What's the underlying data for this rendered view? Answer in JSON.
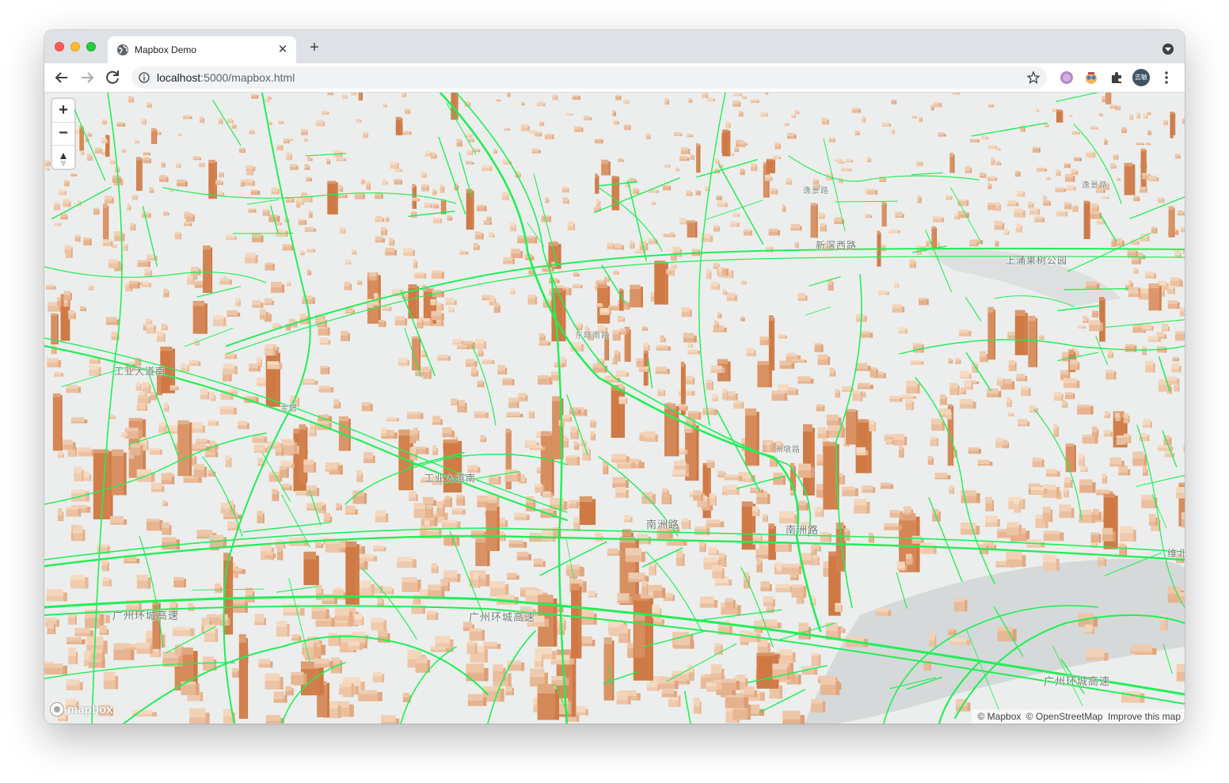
{
  "browser": {
    "tab": {
      "title": "Mapbox Demo",
      "close_glyph": "✕"
    },
    "new_tab_glyph": "+",
    "address": {
      "host": "localhost",
      "rest": ":5000/mapbox.html"
    },
    "profile_initials": "志敏",
    "icons": [
      "back-icon",
      "forward-icon",
      "reload-icon",
      "info-icon",
      "star-icon",
      "extension-icon",
      "puzzle-icon",
      "kebab-menu-icon",
      "tab-search-icon"
    ]
  },
  "map": {
    "controls": {
      "zoom_in": "+",
      "zoom_out": "−"
    },
    "labels": {
      "l1": "上涌果树公园",
      "l2": "新滘西路",
      "l3": "逸景路",
      "l4": "逸景路",
      "l5": "南洲路",
      "l6": "南洲路",
      "l7": "广州环城高速",
      "l8": "广州环城高速",
      "l9": "广州环城高速",
      "l10": "工业大道南",
      "l11": "工业大道南",
      "l12": "东晓南路",
      "l13": "维北",
      "l14": "金碧",
      "l15": "洲墩路"
    },
    "logo_text": "mapbox",
    "attribution": [
      "© Mapbox",
      "© OpenStreetMap",
      "Improve this map"
    ],
    "colors": {
      "roads": "#22ee55",
      "buildings_light": "#f6dcc4",
      "buildings_dark": "#cf7a45",
      "ground": "#eceeed",
      "water": "#d5d9d9"
    }
  }
}
